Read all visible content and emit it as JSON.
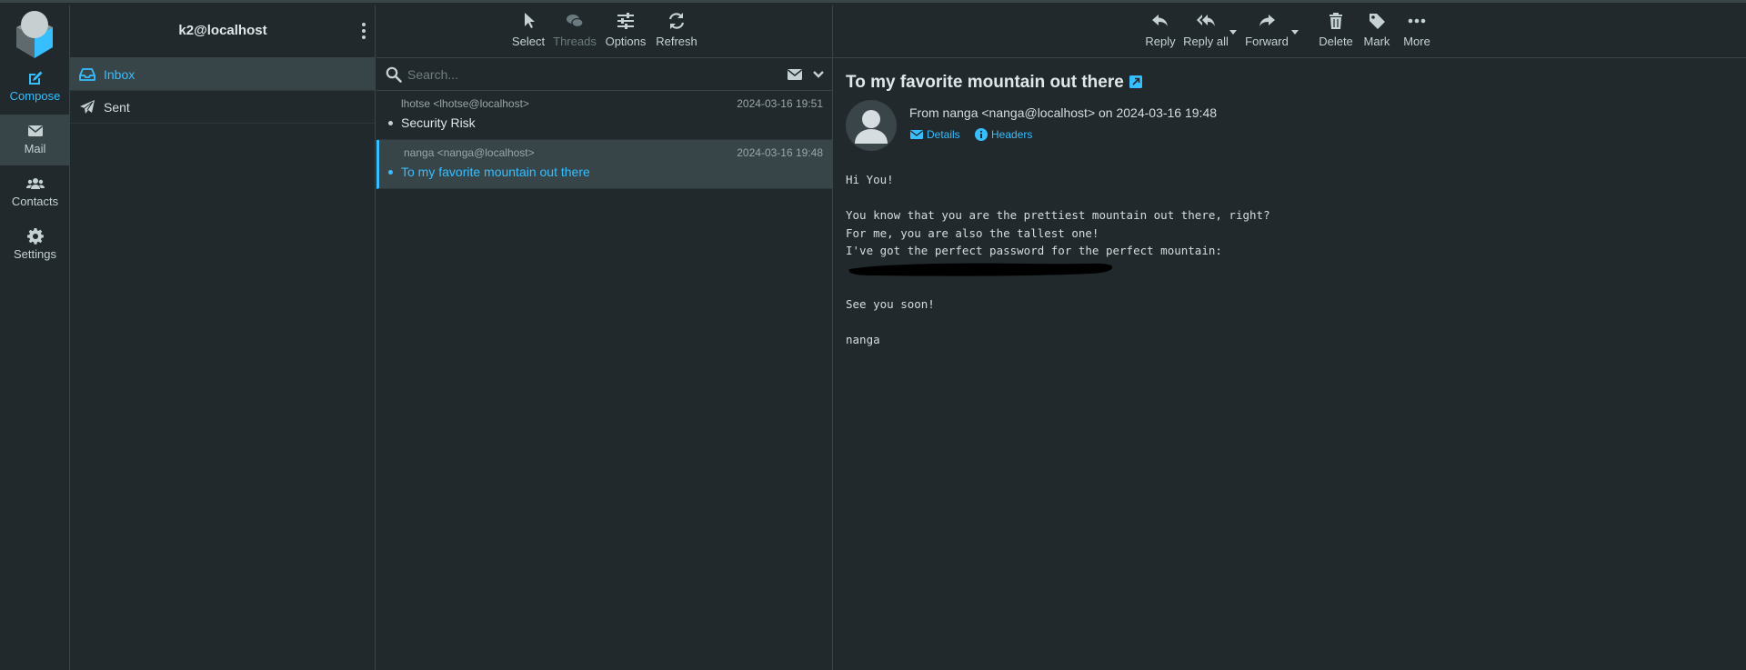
{
  "account": "k2@localhost",
  "rail": {
    "compose": "Compose",
    "mail": "Mail",
    "contacts": "Contacts",
    "settings": "Settings"
  },
  "folders": [
    {
      "name": "Inbox",
      "icon": "inbox-icon",
      "active": true
    },
    {
      "name": "Sent",
      "icon": "paper-plane-icon",
      "active": false
    }
  ],
  "list_toolbar": {
    "select": "Select",
    "threads": "Threads",
    "options": "Options",
    "refresh": "Refresh"
  },
  "search": {
    "placeholder": "Search..."
  },
  "messages": [
    {
      "from": "lhotse <lhotse@localhost>",
      "date": "2024-03-16 19:51",
      "subject": "Security Risk",
      "selected": false
    },
    {
      "from": "nanga <nanga@localhost>",
      "date": "2024-03-16 19:48",
      "subject": "To my favorite mountain out there",
      "selected": true
    }
  ],
  "preview_toolbar": {
    "reply": "Reply",
    "reply_all": "Reply all",
    "forward": "Forward",
    "delete": "Delete",
    "mark": "Mark",
    "more": "More"
  },
  "preview": {
    "subject": "To my favorite mountain out there",
    "from_line": "From nanga <nanga@localhost> on 2024-03-16 19:48",
    "details": "Details",
    "headers": "Headers",
    "body_lines": [
      "Hi You!",
      "",
      "You know that you are the prettiest mountain out there, right?",
      "For me, you are also the tallest one!",
      "I've got the perfect password for the perfect mountain:",
      "",
      "",
      "See you soon!",
      "",
      "nanga"
    ]
  },
  "colors": {
    "background": "#21292c",
    "selected_bg": "#374549",
    "accent": "#37beff",
    "border": "#3a4549"
  }
}
